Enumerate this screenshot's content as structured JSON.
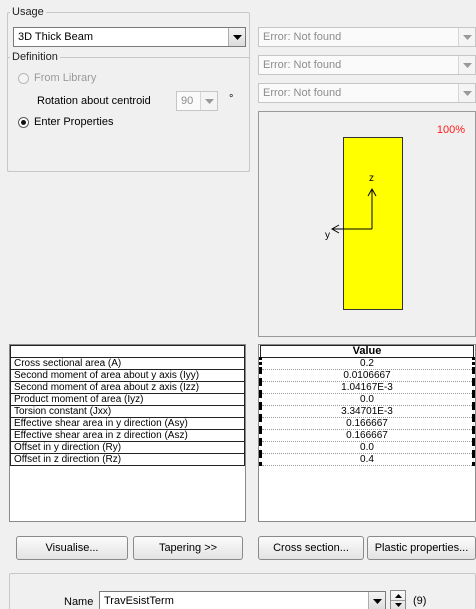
{
  "usage": {
    "legend": "Usage",
    "selected": "3D Thick Beam"
  },
  "definition": {
    "legend": "Definition",
    "from_library_label": "From Library",
    "rotation_label": "Rotation about centroid",
    "rotation_value": "90",
    "rotation_unit": "°",
    "enter_properties_label": "Enter Properties"
  },
  "error_combos": [
    "Error: Not found",
    "Error: Not found",
    "Error: Not found"
  ],
  "preview": {
    "zoom": "100%",
    "axis_z": "z",
    "axis_y": "y",
    "section_color": "#ffff00"
  },
  "properties": {
    "value_header": "Value",
    "rows": [
      {
        "label": "Cross sectional area (A)",
        "value": "0.2"
      },
      {
        "label": "Second moment of area about y axis (Iyy)",
        "value": "0.0106667"
      },
      {
        "label": "Second moment of area about z axis (Izz)",
        "value": "1.04167E-3"
      },
      {
        "label": "Product moment of area (Iyz)",
        "value": "0.0"
      },
      {
        "label": "Torsion constant (Jxx)",
        "value": "3.34701E-3"
      },
      {
        "label": "Effective shear area in y direction (Asy)",
        "value": "0.166667"
      },
      {
        "label": "Effective shear area in z direction (Asz)",
        "value": "0.166667"
      },
      {
        "label": "Offset in y direction (Ry)",
        "value": "0.0"
      },
      {
        "label": "Offset in z direction (Rz)",
        "value": "0.4"
      }
    ]
  },
  "buttons": {
    "visualise": "Visualise...",
    "tapering": "Tapering >>",
    "cross_section": "Cross section...",
    "plastic": "Plastic properties..."
  },
  "name_field": {
    "label": "Name",
    "value": "TravEsistTerm",
    "count": "(9)"
  }
}
